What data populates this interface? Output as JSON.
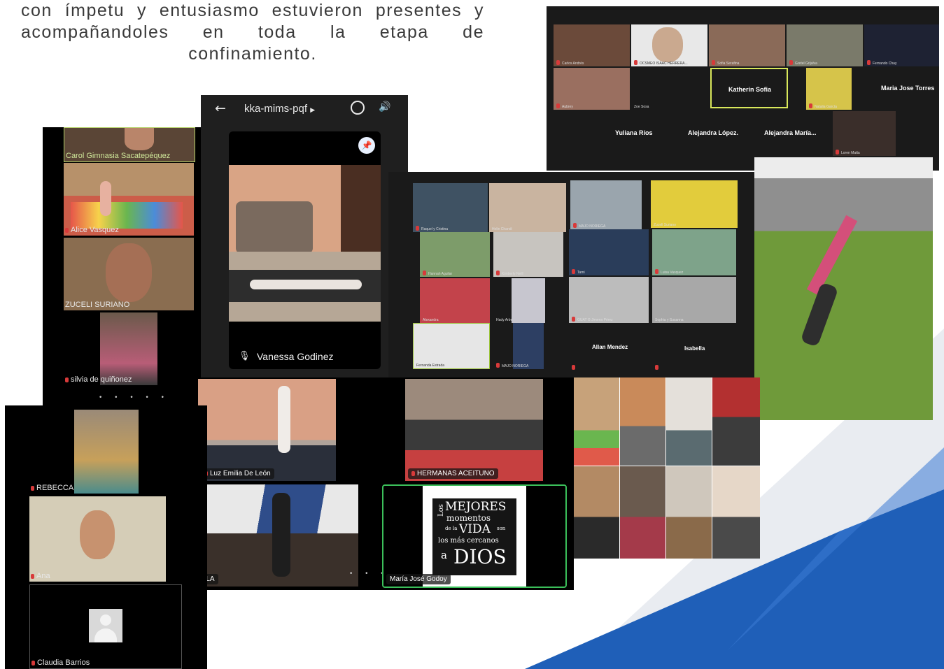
{
  "intro_lines": [
    "con ímpetu y entusiasmo estuvieron presentes y",
    "acompañandoles en toda la etapa de",
    "confinamiento."
  ],
  "meet": {
    "code": "kka-mims-pqf",
    "name": "Vanessa Godinez"
  },
  "left_top_names": [
    "Carol Gimnasia Sacatepéquez",
    "Alice Vasquez",
    "ZUCELI SURIANO",
    "silvia de quiñonez"
  ],
  "left_bottom_names": [
    "REBECCA",
    "Ana",
    "Claudia Barrios"
  ],
  "bottom_mid_names": [
    "Luz Emilia De León",
    "HERMANAS ACEITUNO",
    "ANGELA",
    "María José Godoy"
  ],
  "poster_lines": [
    "Los",
    "MEJORES",
    "momentos",
    "de la",
    "VIDA",
    "son",
    "los más cercanos",
    "a",
    "DIOS"
  ],
  "zoom_top": {
    "row1": [
      "Carlos Andrés",
      "OCSMEO ISAAC HERRERA...",
      "Sofia Serafina",
      "Gretel Grijalva",
      "Fernando Chay"
    ],
    "row2": [
      "Aubrey",
      "Zoe Sosa",
      "Katherin Sofia",
      "Natalia García",
      "Maria Jose Torres"
    ],
    "row3": [
      "Yuliana Ríos",
      "Alejandra López.",
      "Alejandra María...",
      "Loren Matta"
    ]
  },
  "zoom_mid": {
    "names": [
      "Raquel y Cristina",
      "Helin Chandi",
      "MAJO NORIEGA",
      "Zucell Suriano",
      "Hannah Aguilar",
      "Kimberly Neill",
      "Tami",
      "Luisa Vasquez",
      "Alexandra",
      "Hady Arbe",
      "GUAT G Jimena Pérez",
      "Sophia y Susanna",
      "Fernanda Estrada",
      "MAJO NORIEGA"
    ],
    "big_names": [
      "Allan Mendez",
      "Isabella"
    ]
  },
  "colors": {
    "meet_bg": "#1f1f1f",
    "zoom_bg": "#1a1a1a",
    "active_border": "#d9e85b",
    "pin_bg": "#e8f0fe",
    "deco_blue": "#1f5fb8",
    "mic_red": "#d83a3a"
  }
}
